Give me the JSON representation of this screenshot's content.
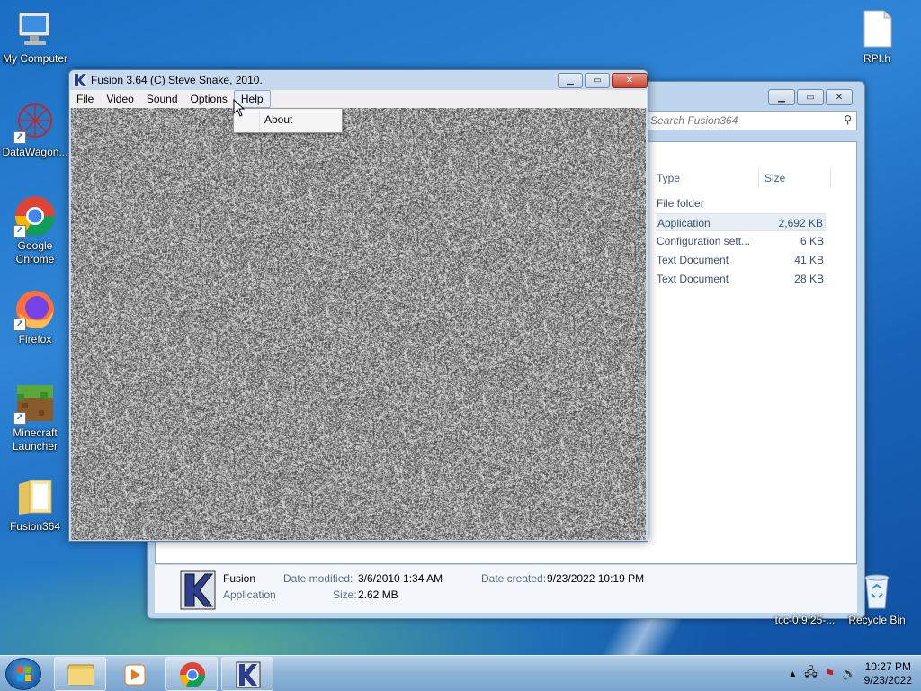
{
  "desktop": {
    "icons_left": [
      {
        "label": "My Computer",
        "icon": "computer-icon"
      },
      {
        "label": "DataWagon...",
        "icon": "datawagon-icon"
      },
      {
        "label": "Google Chrome",
        "icon": "chrome-icon"
      },
      {
        "label": "Firefox",
        "icon": "firefox-icon"
      },
      {
        "label": "Minecraft Launcher",
        "icon": "minecraft-icon"
      },
      {
        "label": "Fusion364",
        "icon": "folder-icon"
      }
    ],
    "rpi_label": "RPI.h",
    "recycle_label": "Recycle Bin",
    "tcc_label": "tcc-0.9.25-..."
  },
  "explorer": {
    "search_placeholder": "Search Fusion364",
    "columns": {
      "type": "Type",
      "size": "Size"
    },
    "rows": [
      {
        "type": "File folder",
        "size": ""
      },
      {
        "type": "Application",
        "size": "2,692 KB"
      },
      {
        "type": "Configuration sett...",
        "size": "6 KB"
      },
      {
        "type": "Text Document",
        "size": "41 KB"
      },
      {
        "type": "Text Document",
        "size": "28 KB"
      }
    ],
    "selected_row": 1,
    "details": {
      "name": "Fusion",
      "kind": "Application",
      "date_modified_label": "Date modified:",
      "date_modified": "3/6/2010 1:34 AM",
      "size_label": "Size:",
      "size": "2.62 MB",
      "date_created_label": "Date created:",
      "date_created": "9/23/2022 10:19 PM"
    }
  },
  "fusion": {
    "title": "Fusion 3.64 (C) Steve Snake, 2010.",
    "menu": [
      "File",
      "Video",
      "Sound",
      "Options",
      "Help"
    ],
    "open_menu": "Help",
    "help_menu_items": [
      "About"
    ]
  },
  "taskbar": {
    "time": "10:27 PM",
    "date": "9/23/2022"
  },
  "colors": {
    "accent": "#1c5fb8",
    "close_red": "#c9452d"
  }
}
